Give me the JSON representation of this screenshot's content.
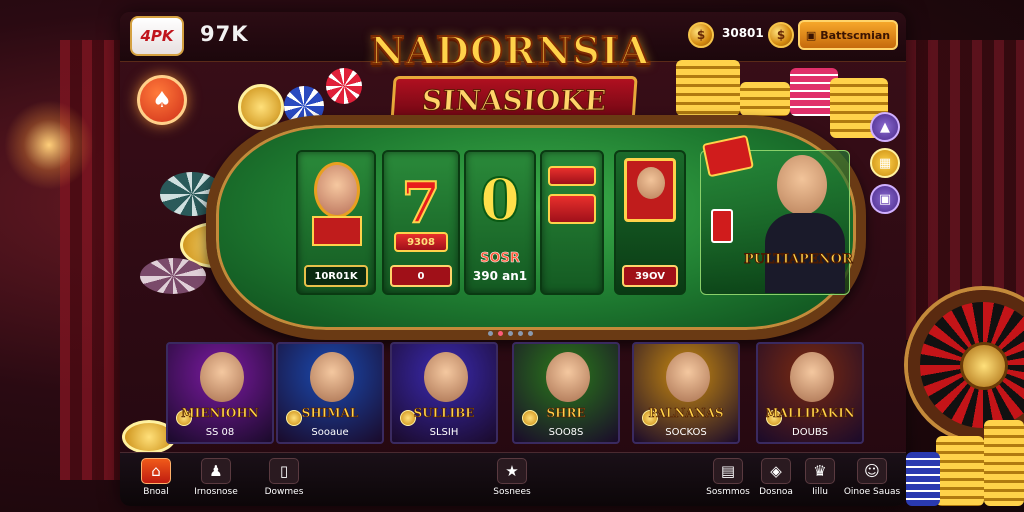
{
  "header": {
    "logo_text": "4PK",
    "brand_text": "97K",
    "coin_count": "30801",
    "action_label": "Battscmian"
  },
  "hero": {
    "title": "NADORNSIA",
    "subtitle": "SINASIOKE"
  },
  "table": {
    "reels": [
      {
        "symbol": "queen",
        "label": "10R01K"
      },
      {
        "symbol": "7",
        "badge": "9308",
        "label": "0"
      },
      {
        "symbol": "0",
        "badge": "SOSR",
        "label": "390 an1"
      },
      {
        "symbol": "player",
        "label": "39OV"
      }
    ],
    "host_label": "PULTIAPENOR",
    "pagination": {
      "total": 5,
      "active": 1
    }
  },
  "games": [
    {
      "name": "MIENIOHN",
      "sub": "SS 08",
      "theme": "#7a1aa0"
    },
    {
      "name": "SHIMAL",
      "sub": "Sooaue",
      "theme": "#1a4ab0"
    },
    {
      "name": "SULLIBE",
      "sub": "SLSIH",
      "theme": "#3a2ab0"
    },
    {
      "name": "SHRE",
      "sub": "SOO8S",
      "theme": "#2a7a1a"
    },
    {
      "name": "PALNANAS",
      "sub": "SOCKOS",
      "theme": "#c88a10"
    },
    {
      "name": "MALLIPAKIN",
      "sub": "DOUBS",
      "theme": "#7a2a10"
    }
  ],
  "nav": [
    {
      "icon": "home-icon",
      "label": "Bnoal",
      "glyph": "⌂",
      "active": true
    },
    {
      "icon": "person-icon",
      "label": "Irnosnose",
      "glyph": "♟",
      "active": false
    },
    {
      "icon": "book-icon",
      "label": "Dowmes",
      "glyph": "▯",
      "active": false
    },
    {
      "icon": "trophy-icon",
      "label": "Sosnees",
      "glyph": "★",
      "active": false
    },
    {
      "icon": "wallet-icon",
      "label": "Sosmmos",
      "glyph": "▤",
      "active": false
    },
    {
      "icon": "gift-icon",
      "label": "Dosnoa",
      "glyph": "◈",
      "active": false
    },
    {
      "icon": "crown-icon",
      "label": "Iillu",
      "glyph": "♛",
      "active": false
    },
    {
      "icon": "profile-icon",
      "label": "Oinoe Sauas",
      "glyph": "☺",
      "active": false
    }
  ],
  "colors": {
    "accent": "#f05a1a",
    "gold": "#ffd24a",
    "felt": "#2a9a3a"
  }
}
